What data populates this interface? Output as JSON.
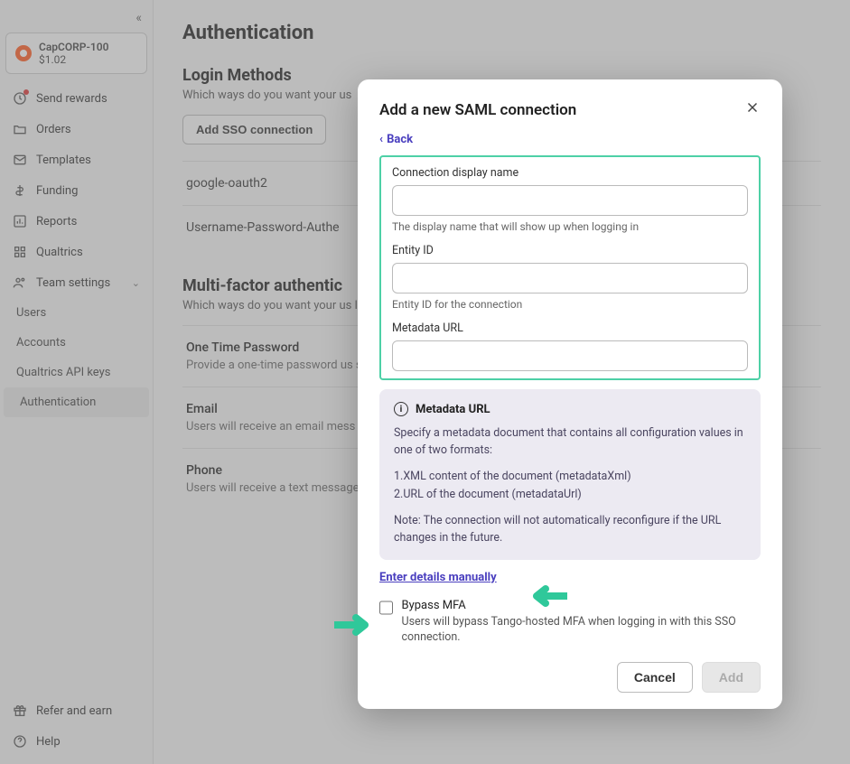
{
  "sidebar": {
    "org": {
      "name": "CapCORP-100",
      "balance": "$1.02"
    },
    "items": [
      {
        "label": "Send rewards",
        "icon": "send"
      },
      {
        "label": "Orders",
        "icon": "folder"
      },
      {
        "label": "Templates",
        "icon": "mail"
      },
      {
        "label": "Funding",
        "icon": "dollar"
      },
      {
        "label": "Reports",
        "icon": "chart"
      },
      {
        "label": "Qualtrics",
        "icon": "grid"
      },
      {
        "label": "Team settings",
        "icon": "people"
      }
    ],
    "sub": [
      {
        "label": "Users"
      },
      {
        "label": "Accounts"
      },
      {
        "label": "Qualtrics API keys"
      },
      {
        "label": "Authentication",
        "active": true
      }
    ],
    "footer": [
      {
        "label": "Refer and earn",
        "icon": "gift"
      },
      {
        "label": "Help",
        "icon": "help"
      }
    ]
  },
  "page": {
    "title": "Authentication",
    "login": {
      "heading": "Login Methods",
      "sub": "Which ways do you want your us",
      "add_btn": "Add SSO connection",
      "rows": [
        "google-oauth2",
        "Username-Password-Authe"
      ]
    },
    "mfa": {
      "heading": "Multi-factor authentic",
      "sub": "Which ways do you want your us logging in to Tango?",
      "methods": [
        {
          "title": "One Time Password",
          "desc": "Provide a one-time password us similar."
        },
        {
          "title": "Email",
          "desc": "Users will receive an email mess"
        },
        {
          "title": "Phone",
          "desc": "Users will receive a text message verification code."
        }
      ]
    }
  },
  "modal": {
    "title": "Add a new SAML connection",
    "back": "Back",
    "fields": {
      "display_name": {
        "label": "Connection display name",
        "help": "The display name that will show up when logging in"
      },
      "entity_id": {
        "label": "Entity ID",
        "help": "Entity ID for the connection"
      },
      "metadata_url": {
        "label": "Metadata URL"
      }
    },
    "info": {
      "heading": "Metadata URL",
      "p1": "Specify a metadata document that contains all configuration values in one of two formats:",
      "l1": "1.XML content of the document (metadataXml)",
      "l2": "2.URL of the document (metadataUrl)",
      "note": "Note: The connection will not automatically reconfigure if the URL changes in the future."
    },
    "manual_link": "Enter details manually",
    "bypass": {
      "title": "Bypass MFA",
      "desc": "Users will bypass Tango-hosted MFA when logging in with this SSO connection."
    },
    "actions": {
      "cancel": "Cancel",
      "add": "Add"
    }
  }
}
